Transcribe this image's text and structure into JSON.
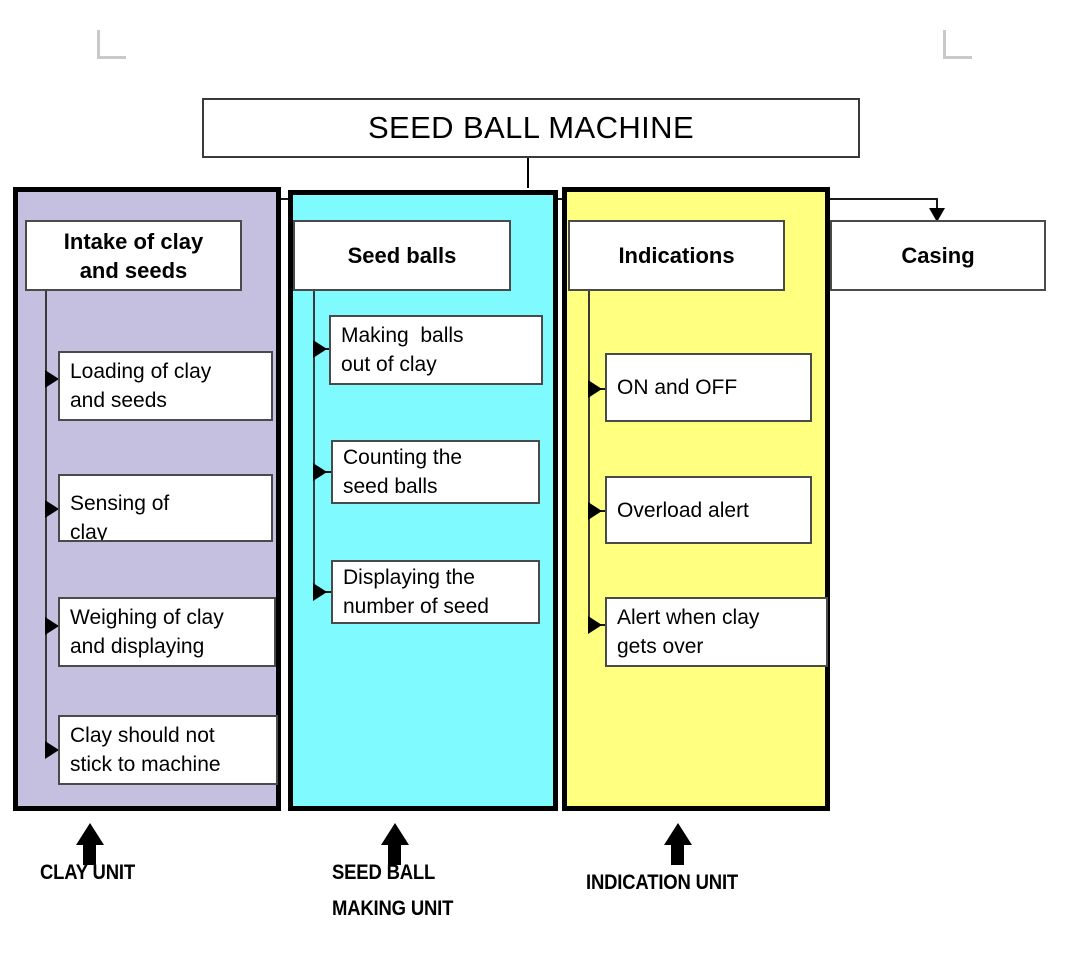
{
  "title": {
    "text": "SEED BALL MACHINE"
  },
  "units": [
    {
      "id": "clay",
      "color": "#c5bfe0",
      "header": "Intake of clay\nand seeds",
      "items": [
        "Loading of clay\nand seeds",
        "Sensing of\nclay",
        "Weighing of clay\nand displaying",
        "Clay should not\nstick to machine"
      ],
      "caption": "CLAY UNIT"
    },
    {
      "id": "seed",
      "color": "#7ffbff",
      "header": "Seed balls",
      "items": [
        "Making  balls\nout of clay",
        "Counting the\nseed balls",
        "Displaying the\nnumber of seed"
      ],
      "caption": "SEED BALL\nMAKING UNIT"
    },
    {
      "id": "indication",
      "color": "#ffff80",
      "header": "Indications",
      "items": [
        "ON and OFF",
        "Overload alert",
        "Alert when clay\ngets over"
      ],
      "caption": "INDICATION UNIT"
    },
    {
      "id": "casing",
      "color": "#ffffff",
      "header": "Casing",
      "items": [],
      "caption": ""
    }
  ]
}
